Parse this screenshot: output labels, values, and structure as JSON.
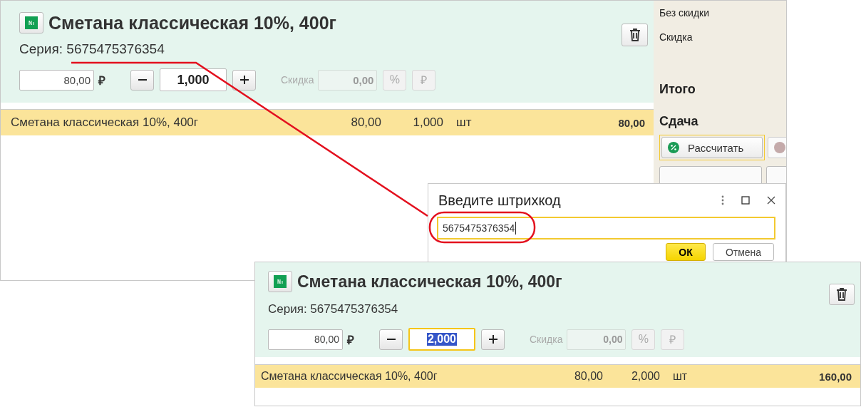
{
  "cards": [
    {
      "title": "Сметана классическая 10%, 400г",
      "series_label": "Серия:",
      "series": "5675475376354",
      "price": "80,00",
      "currency": "₽",
      "qty": "1,000",
      "qty_selected": false,
      "discount_label": "Скидка",
      "discount": "0,00",
      "percent_button": "%",
      "ruble_button": "₽",
      "row": {
        "name": "Сметана классическая 10%, 400г",
        "price": "80,00",
        "qty": "1,000",
        "unit": "шт",
        "sum": "80,00"
      }
    },
    {
      "title": "Сметана классическая 10%, 400г",
      "series_label": "Серия:",
      "series": "5675475376354",
      "price": "80,00",
      "currency": "₽",
      "qty": "2,000",
      "qty_selected": true,
      "discount_label": "Скидка",
      "discount": "0,00",
      "percent_button": "%",
      "ruble_button": "₽",
      "row": {
        "name": "Сметана классическая 10%, 400г",
        "price": "80,00",
        "qty": "2,000",
        "unit": "шт",
        "sum": "160,00"
      }
    }
  ],
  "sidebar": {
    "no_discount": "Без скидки",
    "discount": "Скидка",
    "total": "Итого",
    "change": "Сдача",
    "calculate_button": "Рассчитать"
  },
  "dialog": {
    "title": "Введите штрихкод",
    "value": "5675475376354",
    "ok_button": "ОК",
    "cancel_button": "Отмена"
  }
}
